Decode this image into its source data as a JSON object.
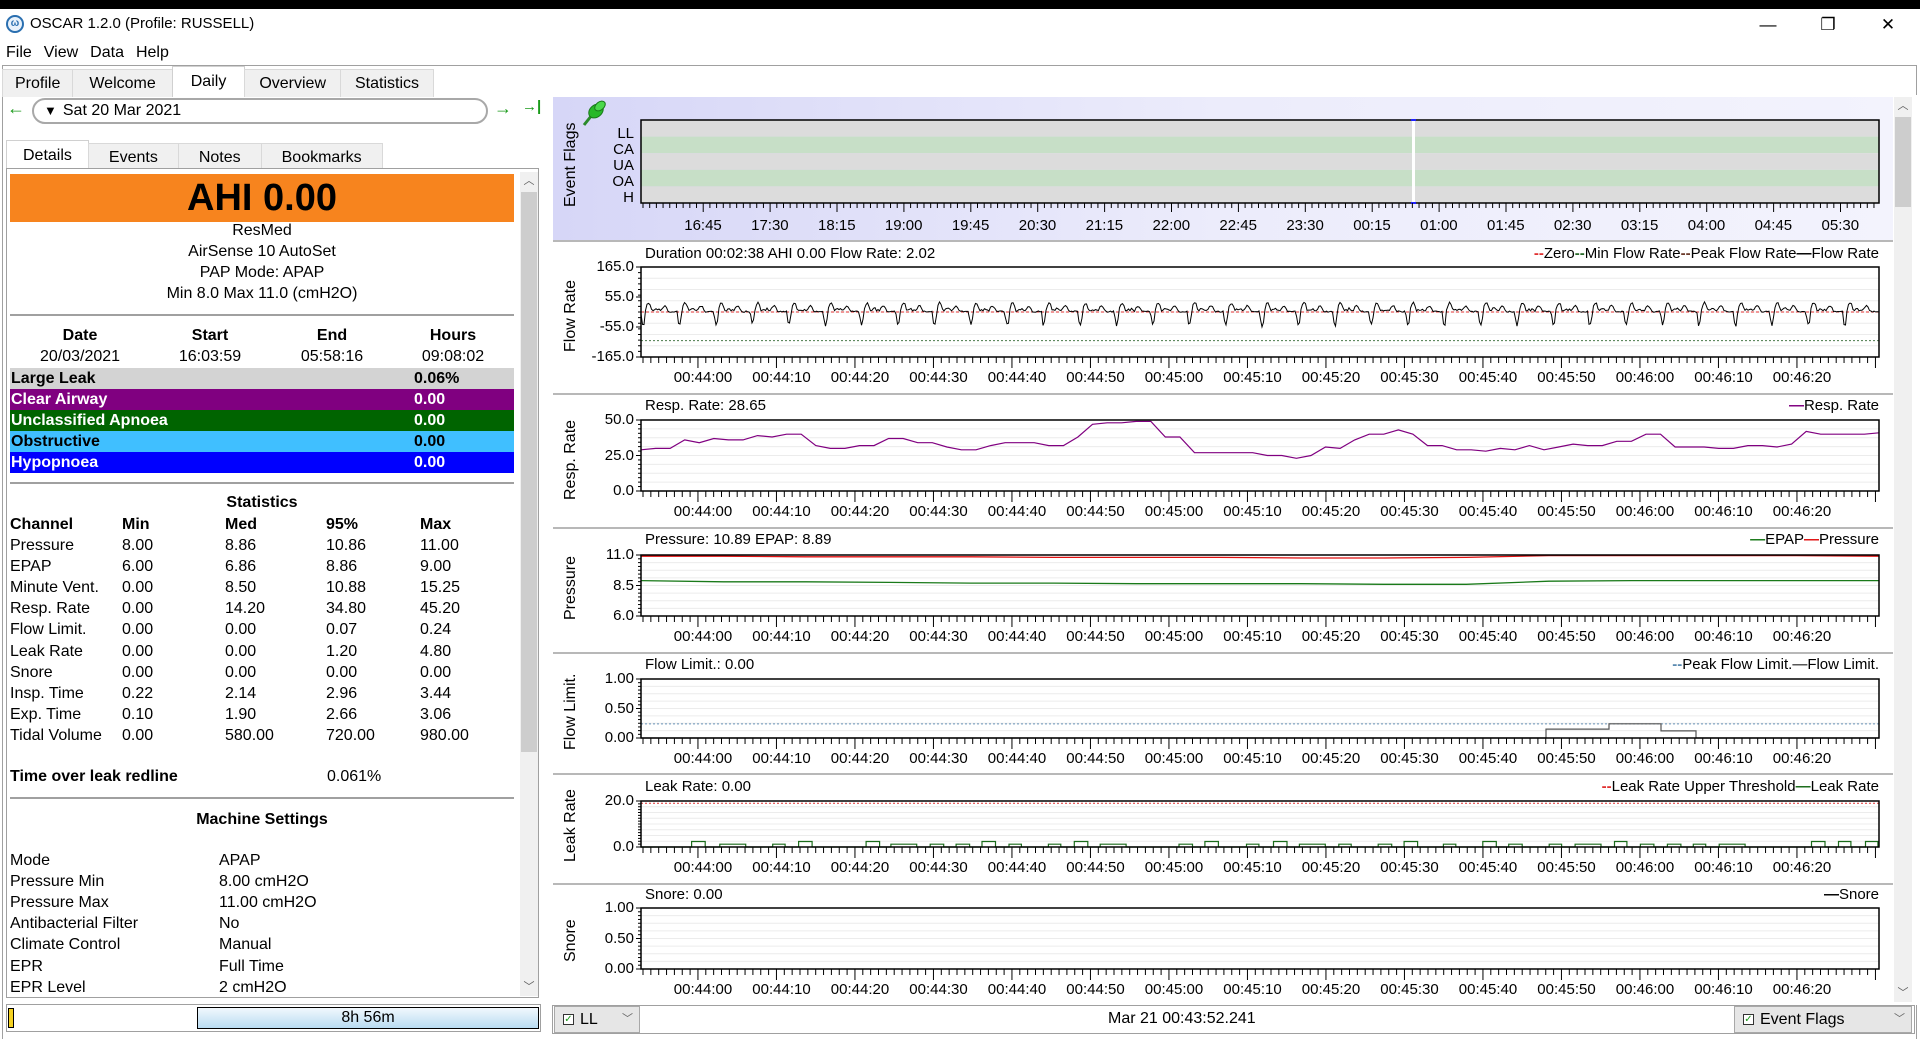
{
  "window": {
    "title": "OSCAR 1.2.0 (Profile: RUSSELL)",
    "minimize": "—",
    "restore": "❐",
    "close": "✕"
  },
  "menu": [
    "File",
    "View",
    "Data",
    "Help"
  ],
  "main_tabs": [
    {
      "label": "Profile",
      "active": false
    },
    {
      "label": "Welcome",
      "active": false
    },
    {
      "label": "Daily",
      "active": true
    },
    {
      "label": "Overview",
      "active": false
    },
    {
      "label": "Statistics",
      "active": false
    }
  ],
  "date_nav": {
    "prev_icon": "←",
    "date": "Sat 20 Mar 2021",
    "dropdown_icon": "▼",
    "next_icon": "→",
    "last_icon": "→|"
  },
  "left_tabs": [
    {
      "label": "Details",
      "active": true
    },
    {
      "label": "Events",
      "active": false
    },
    {
      "label": "Notes",
      "active": false
    },
    {
      "label": "Bookmarks",
      "active": false
    }
  ],
  "details": {
    "ahi": "AHI 0.00",
    "ahi_color": "#f7841e",
    "brand": "ResMed",
    "model": "AirSense 10 AutoSet",
    "pap_mode": "PAP Mode: APAP",
    "pressure_range": "Min 8.0 Max 11.0 (cmH2O)",
    "summary_headers": [
      "Date",
      "Start",
      "End",
      "Hours"
    ],
    "summary_values": [
      "20/03/2021",
      "16:03:59",
      "05:58:16",
      "09:08:02"
    ],
    "events": [
      {
        "label": "Large Leak",
        "value": "0.06%",
        "bg": "#d3d3d3",
        "fg": "#000000"
      },
      {
        "label": "Clear Airway",
        "value": "0.00",
        "bg": "#800080",
        "fg": "#ffffff"
      },
      {
        "label": "Unclassified Apnoea",
        "value": "0.00",
        "bg": "#006400",
        "fg": "#ffffff"
      },
      {
        "label": "Obstructive",
        "value": "0.00",
        "bg": "#40bfff",
        "fg": "#000000"
      },
      {
        "label": "Hypopnoea",
        "value": "0.00",
        "bg": "#0000ff",
        "fg": "#ffffff"
      }
    ],
    "statistics": {
      "title": "Statistics",
      "headers": [
        "Channel",
        "Min",
        "Med",
        "95%",
        "Max"
      ],
      "rows": [
        [
          "Pressure",
          "8.00",
          "8.86",
          "10.86",
          "11.00"
        ],
        [
          "EPAP",
          "6.00",
          "6.86",
          "8.86",
          "9.00"
        ],
        [
          "Minute Vent.",
          "0.00",
          "8.50",
          "10.88",
          "15.25"
        ],
        [
          "Resp. Rate",
          "0.00",
          "14.20",
          "34.80",
          "45.20"
        ],
        [
          "Flow Limit.",
          "0.00",
          "0.00",
          "0.07",
          "0.24"
        ],
        [
          "Leak Rate",
          "0.00",
          "0.00",
          "1.20",
          "4.80"
        ],
        [
          "Snore",
          "0.00",
          "0.00",
          "0.00",
          "0.00"
        ],
        [
          "Insp. Time",
          "0.22",
          "2.14",
          "2.96",
          "3.44"
        ],
        [
          "Exp. Time",
          "0.10",
          "1.90",
          "2.66",
          "3.06"
        ],
        [
          "Tidal Volume",
          "0.00",
          "580.00",
          "720.00",
          "980.00"
        ]
      ]
    },
    "leak_redline_label": "Time over leak redline",
    "leak_redline_value": "0.061%",
    "machine_settings": {
      "title": "Machine Settings",
      "rows": [
        [
          "Mode",
          "APAP"
        ],
        [
          "Pressure Min",
          "8.00 cmH2O"
        ],
        [
          "Pressure Max",
          "11.00 cmH2O"
        ],
        [
          "Antibacterial Filter",
          "No"
        ],
        [
          "Climate Control",
          "Manual"
        ],
        [
          "EPR",
          "Full Time"
        ],
        [
          "EPR Level",
          "2 cmH2O"
        ]
      ]
    }
  },
  "left_bottom": {
    "hours_bar": "8h 56m"
  },
  "event_flags_chart": {
    "ylabel": "Event Flags",
    "rows": [
      "LL",
      "CA",
      "UA",
      "OA",
      "H"
    ],
    "time_labels": [
      "16:45",
      "17:30",
      "18:15",
      "19:00",
      "19:45",
      "20:30",
      "21:15",
      "22:00",
      "22:45",
      "23:30",
      "00:15",
      "01:00",
      "01:45",
      "02:30",
      "03:15",
      "04:00",
      "04:45",
      "05:30"
    ],
    "pin_icon": "pushpin-icon"
  },
  "time_axis": [
    "00:44:00",
    "00:44:10",
    "00:44:20",
    "00:44:30",
    "00:44:40",
    "00:44:50",
    "00:45:00",
    "00:45:10",
    "00:45:20",
    "00:45:30",
    "00:45:40",
    "00:45:50",
    "00:46:00",
    "00:46:10",
    "00:46:20"
  ],
  "charts": {
    "flow": {
      "ylabel": "Flow Rate",
      "title": "Duration 00:02:38 AHI 0.00 Flow Rate: 2.02",
      "yticks": [
        "165.0",
        "55.0",
        "-55.0",
        "-165.0"
      ],
      "legend": [
        {
          "label": "Zero",
          "color": "#e03030",
          "dashed": true
        },
        {
          "label": "Min Flow Rate",
          "color": "#2a6b2a",
          "dashed": true
        },
        {
          "label": "Peak Flow Rate",
          "color": "#6b3a2a",
          "dashed": true
        },
        {
          "label": "Flow Rate",
          "color": "#000000",
          "dashed": false
        }
      ]
    },
    "resp": {
      "ylabel": "Resp. Rate",
      "title": "Resp. Rate: 28.65",
      "yticks": [
        "50.0",
        "25.0",
        "0.0"
      ],
      "legend": [
        {
          "label": "Resp. Rate",
          "color": "#800080",
          "dashed": false
        }
      ],
      "values": [
        29,
        30,
        30,
        36,
        34,
        37,
        36,
        36,
        39,
        38,
        40,
        40,
        32,
        30,
        30,
        32,
        32,
        37,
        37,
        34,
        34,
        31,
        29,
        29,
        32,
        34,
        34,
        34,
        32,
        32,
        38,
        47,
        48,
        48,
        49,
        49,
        38,
        38,
        27,
        27,
        27,
        27,
        27,
        25,
        25,
        23,
        25,
        31,
        30,
        36,
        40,
        40,
        43,
        40,
        32,
        32,
        29,
        29,
        28,
        30,
        29,
        32,
        29,
        31,
        33,
        32,
        32,
        35,
        35,
        40,
        40,
        31,
        31,
        31,
        30,
        30,
        32,
        32,
        31,
        33,
        42,
        40,
        40,
        40,
        40,
        41
      ]
    },
    "pressure": {
      "ylabel": "Pressure",
      "title": "Pressure: 10.89 EPAP: 8.89",
      "yticks": [
        "11.0",
        "8.5",
        "6.0"
      ],
      "legend": [
        {
          "label": "EPAP",
          "color": "#1a7a1a",
          "dashed": false
        },
        {
          "label": "Pressure",
          "color": "#e01010",
          "dashed": false
        }
      ],
      "pressure_values": [
        10.9,
        10.9,
        10.85,
        10.85,
        10.85,
        10.8,
        10.8,
        10.8,
        10.75,
        10.75,
        10.8,
        10.95,
        10.95,
        10.95,
        10.95,
        10.9
      ],
      "epap_values": [
        8.9,
        8.8,
        8.8,
        8.75,
        8.7,
        8.7,
        8.65,
        8.65,
        8.65,
        8.6,
        8.6,
        8.85,
        8.9,
        8.9,
        8.9,
        8.9
      ]
    },
    "flow_limit": {
      "ylabel": "Flow Limit.",
      "title": "Flow Limit.: 0.00",
      "yticks": [
        "1.00",
        "0.50",
        "0.00"
      ],
      "peak": 0.24,
      "legend": [
        {
          "label": "Peak Flow Limit.",
          "color": "#5a8ab0",
          "dashed": true
        },
        {
          "label": "Flow Limit.",
          "color": "#555555",
          "dashed": false
        }
      ]
    },
    "leak": {
      "ylabel": "Leak Rate",
      "title": "Leak Rate: 0.00",
      "yticks": [
        "20.0",
        "0.0"
      ],
      "threshold": 19,
      "legend": [
        {
          "label": "Leak Rate Upper Threshold",
          "color": "#e03030",
          "dashed": true
        },
        {
          "label": "Leak Rate",
          "color": "#1a6b1a",
          "dashed": false
        }
      ]
    },
    "snore": {
      "ylabel": "Snore",
      "title": "Snore: 0.00",
      "yticks": [
        "1.00",
        "0.50",
        "0.00"
      ],
      "legend": [
        {
          "label": "Snore",
          "color": "#000000",
          "dashed": false
        }
      ]
    }
  },
  "bottom_bar": {
    "left_combo": "LL",
    "timestamp": "Mar 21 00:43:52.241",
    "right_combo": "Event Flags"
  }
}
